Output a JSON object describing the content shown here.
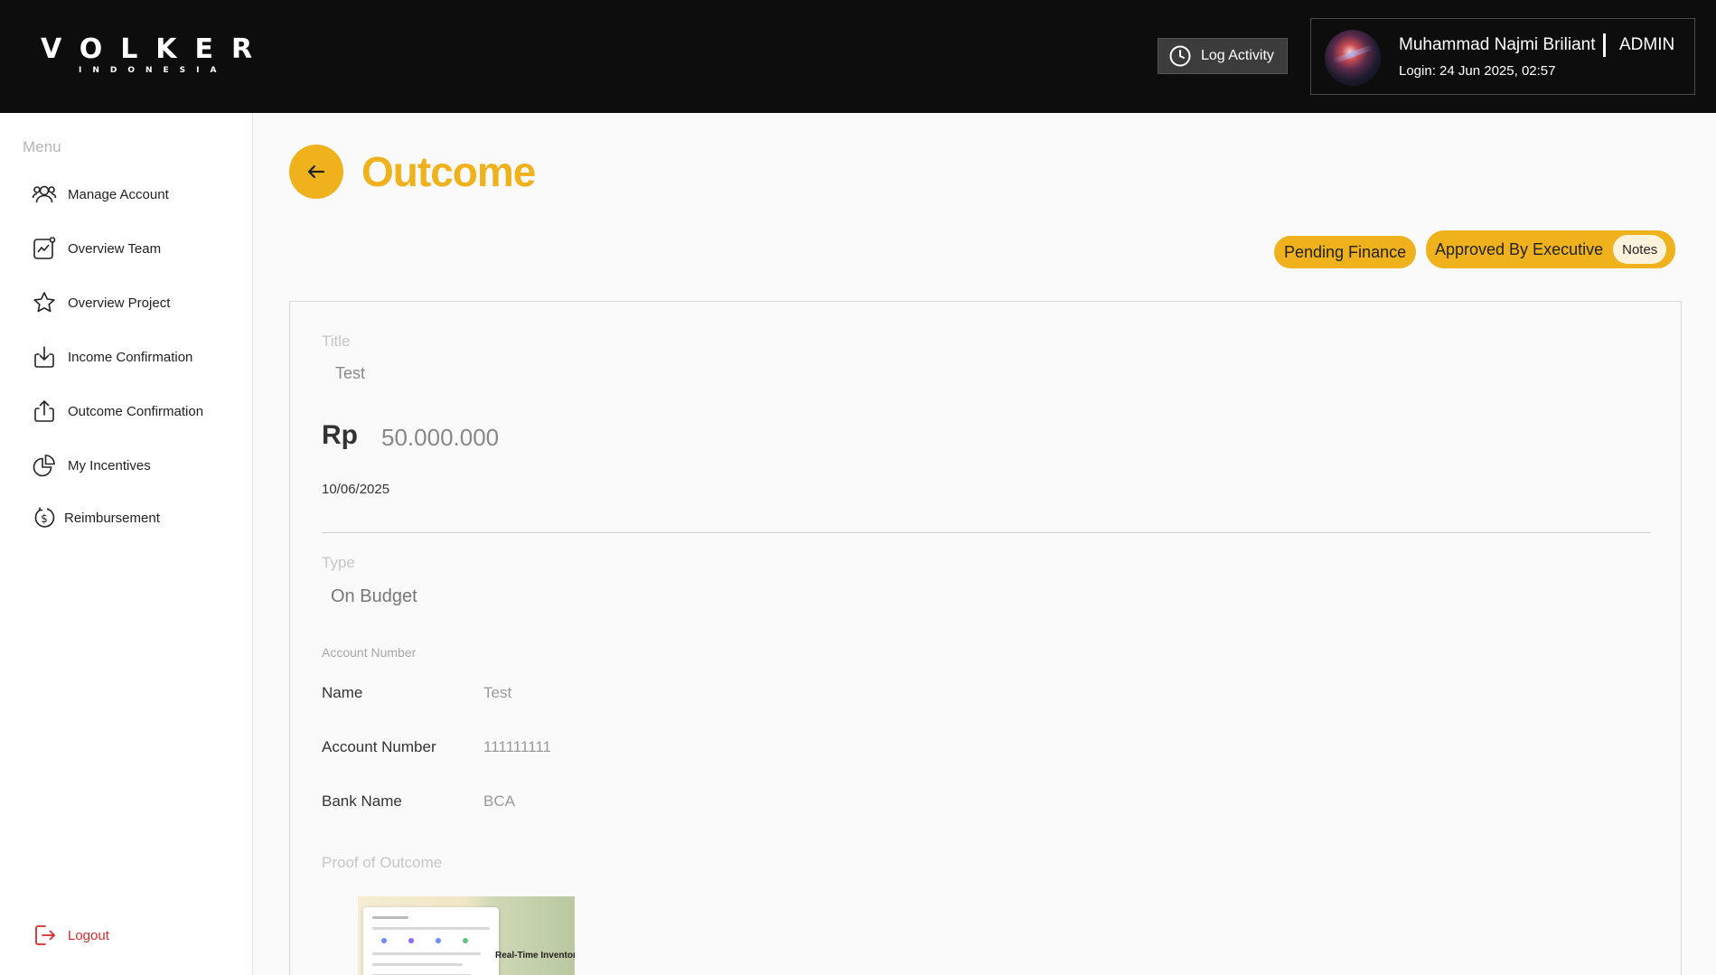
{
  "header": {
    "logo_main": "VOLKER",
    "logo_sub": "INDONESIA",
    "log_activity_label": "Log Activity",
    "user": {
      "name": "Muhammad Najmi Briliant",
      "role": "ADMIN",
      "login": "Login: 24 Jun 2025, 02:57"
    }
  },
  "sidebar": {
    "menu_label": "Menu",
    "items": [
      {
        "label": "Manage Account",
        "icon": "users-icon"
      },
      {
        "label": "Overview Team",
        "icon": "chart-trend-icon"
      },
      {
        "label": "Overview Project",
        "icon": "star-icon"
      },
      {
        "label": "Income Confirmation",
        "icon": "download-tray-icon"
      },
      {
        "label": "Outcome Confirmation",
        "icon": "upload-tray-icon"
      },
      {
        "label": "My Incentives",
        "icon": "pie-chart-icon"
      },
      {
        "label": "Reimbursement",
        "icon": "dollar-coin-icon"
      }
    ],
    "logout_label": "Logout"
  },
  "main": {
    "title": "Outcome",
    "status_pending": "Pending Finance",
    "status_approved": "Approved By Executive",
    "notes_label": "Notes",
    "detail": {
      "title_label": "Title",
      "title_value": "Test",
      "currency": "Rp",
      "amount": "50.000.000",
      "date": "10/06/2025",
      "type_label": "Type",
      "type_value": "On Budget",
      "account_section_label": "Account Number",
      "name_label": "Name",
      "name_value": "Test",
      "account_number_label": "Account Number",
      "account_number_value": "111111111",
      "bank_name_label": "Bank Name",
      "bank_name_value": "BCA",
      "proof_label": "Proof of Outcome",
      "proof_caption": "Real-Time Inventory"
    }
  },
  "colors": {
    "accent": "#f0b21c",
    "header_bg": "#0d0d0d",
    "logout": "#d42a2a"
  }
}
